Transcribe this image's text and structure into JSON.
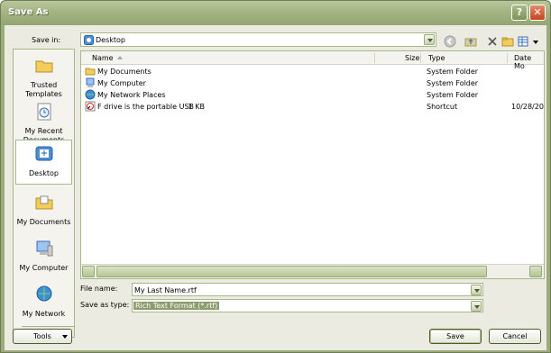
{
  "window": {
    "title": "Save As"
  },
  "toolbar": {
    "save_in_label": "Save in:",
    "location": "Desktop",
    "icons": [
      "back-icon",
      "up-folder-icon",
      "delete-icon",
      "new-folder-icon",
      "views-icon"
    ]
  },
  "places": [
    {
      "label": "Trusted Templates",
      "icon": "folder-icon"
    },
    {
      "label": "My Recent Documents",
      "icon": "recent-documents-icon"
    },
    {
      "label": "Desktop",
      "icon": "desktop-icon",
      "selected": true
    },
    {
      "label": "My Documents",
      "icon": "my-documents-icon"
    },
    {
      "label": "My Computer",
      "icon": "my-computer-icon"
    },
    {
      "label": "My Network",
      "icon": "network-icon"
    }
  ],
  "filelist": {
    "columns": [
      "Name",
      "Size",
      "Type",
      "Date Mo"
    ],
    "rows": [
      {
        "name": "My Documents",
        "size": "",
        "type": "System Folder",
        "date": ""
      },
      {
        "name": "My Computer",
        "size": "",
        "type": "System Folder",
        "date": ""
      },
      {
        "name": "My Network Places",
        "size": "",
        "type": "System Folder",
        "date": ""
      },
      {
        "name": "F drive is the portable USB",
        "size": "1 KB",
        "type": "Shortcut",
        "date": "10/28/20"
      }
    ]
  },
  "form": {
    "filename_label": "File name:",
    "filename_value": "My Last Name.rtf",
    "savetype_label": "Save as type:",
    "savetype_value": "Rich Text Format (*.rtf)"
  },
  "buttons": {
    "tools": "Tools",
    "save": "Save",
    "cancel": "Cancel"
  },
  "colors": {
    "titlebar": "#a3b483",
    "accent": "#8c9c6c",
    "close": "#c3451f"
  }
}
